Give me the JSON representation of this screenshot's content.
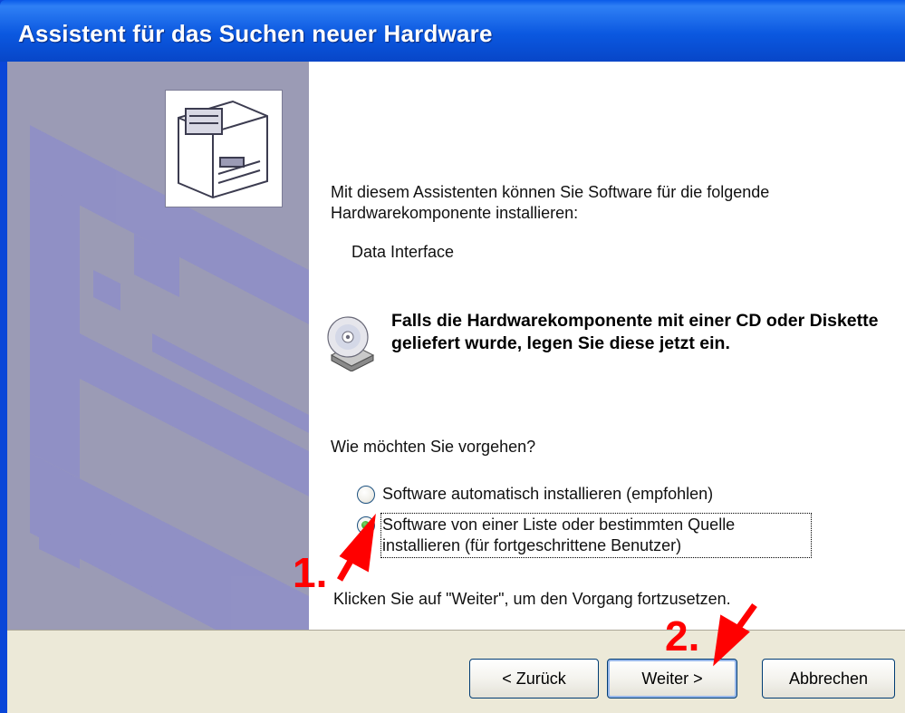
{
  "window": {
    "title": "Assistent für das Suchen neuer Hardware"
  },
  "content": {
    "intro": "Mit diesem Assistenten können Sie Software für die folgende Hardwarekomponente installieren:",
    "device_name": "Data Interface",
    "cd_note": "Falls die Hardwarekomponente mit einer CD oder Diskette geliefert wurde, legen Sie diese jetzt ein.",
    "question": "Wie möchten Sie vorgehen?",
    "options": [
      {
        "label": "Software automatisch installieren (empfohlen)",
        "selected": false
      },
      {
        "label": "Software von einer Liste oder bestimmten Quelle installieren (für fortgeschrittene Benutzer)",
        "selected": true
      }
    ],
    "continue_note": "Klicken Sie auf \"Weiter\", um den Vorgang fortzusetzen."
  },
  "buttons": {
    "back": "< Zurück",
    "next": "Weiter >",
    "cancel": "Abbrechen"
  },
  "annotations": {
    "step1": "1.",
    "step2": "2.",
    "color": "#ff0000"
  },
  "colors": {
    "titlebar": "#0b58e0",
    "side_panel": "#9b9bb5",
    "button_bar": "#ece9d8"
  }
}
